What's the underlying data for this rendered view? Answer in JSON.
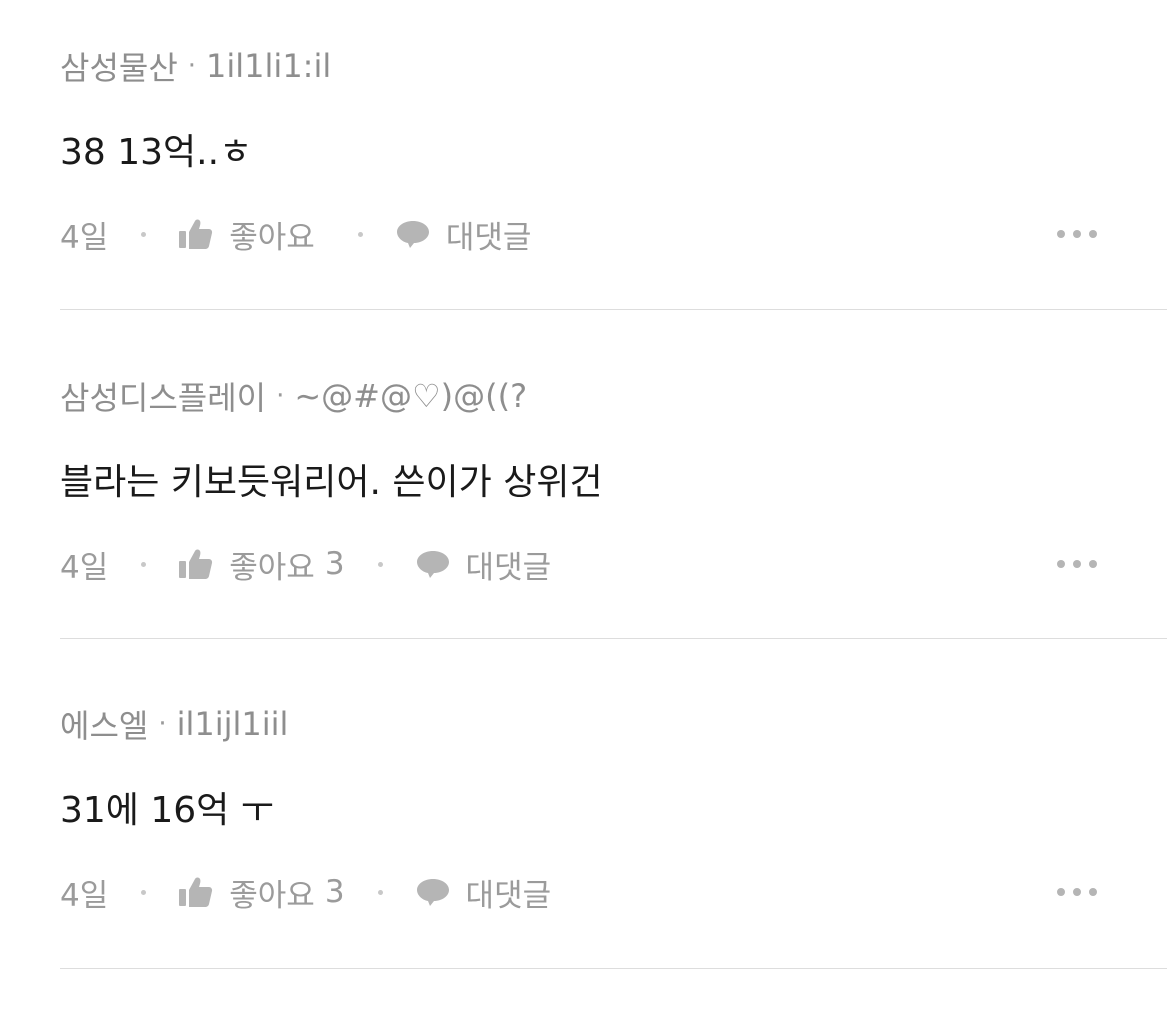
{
  "comments": [
    {
      "company": "삼성물산",
      "username": "1il1li1:il",
      "text": "38 13억..ㅎ",
      "time": "4일",
      "like_label": "좋아요",
      "like_count": "",
      "reply_label": "대댓글"
    },
    {
      "company": "삼성디스플레이",
      "username": "~@#@♡)@((?",
      "text": "블라는 키보듯워리어. 쓴이가 상위건",
      "time": "4일",
      "like_label": "좋아요",
      "like_count": "3",
      "reply_label": "대댓글"
    },
    {
      "company": "에스엘",
      "username": "il1ijl1iil",
      "text": "31에 16억 ㅜ",
      "time": "4일",
      "like_label": "좋아요",
      "like_count": "3",
      "reply_label": "대댓글"
    }
  ],
  "separator": "·",
  "icons": {
    "like": "thumbs-up-icon",
    "reply": "speech-bubble-icon",
    "more": "more-dots-icon"
  },
  "colors": {
    "meta_text": "#8e8e8e",
    "body_text": "#1a1a1a",
    "icon": "#b5b5b5",
    "divider": "#dddddd"
  }
}
